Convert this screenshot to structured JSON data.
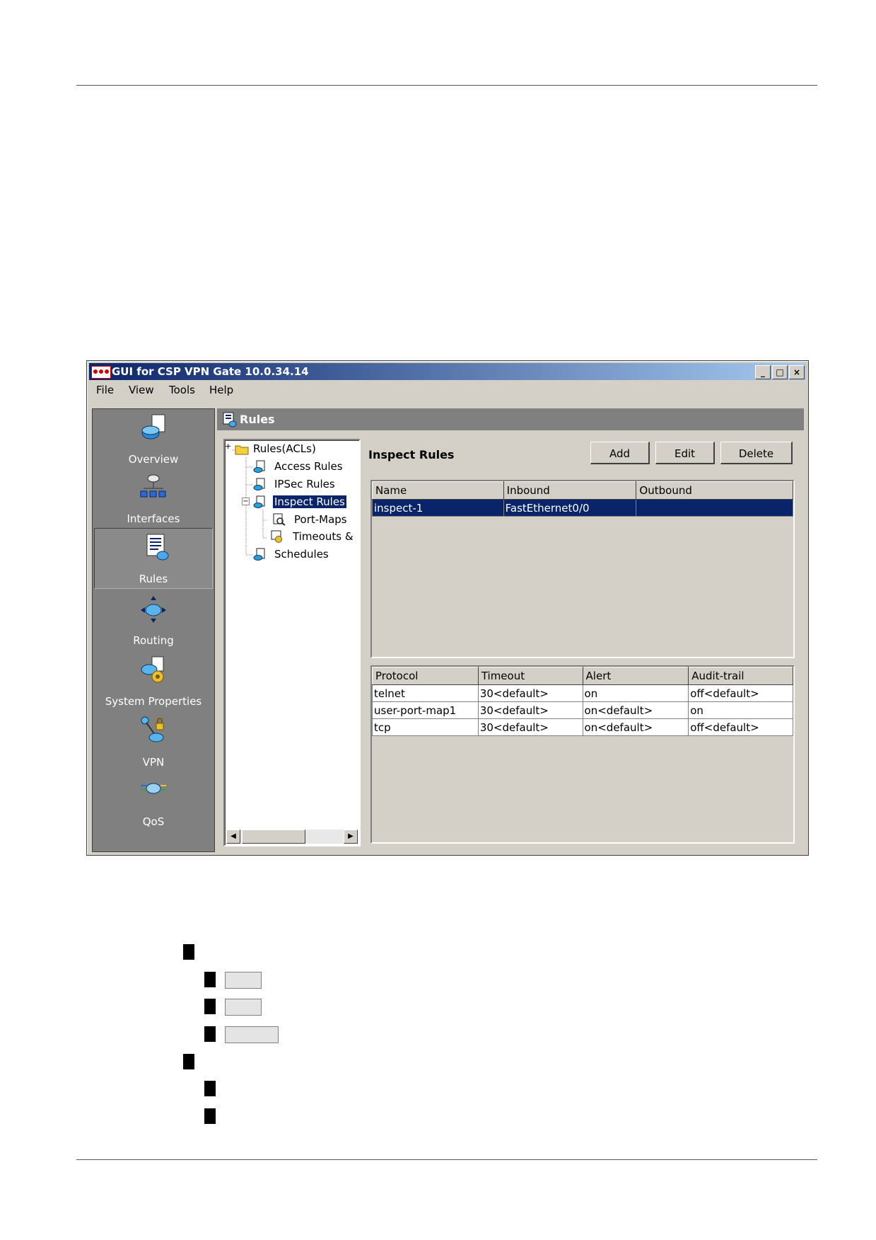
{
  "window": {
    "title": "GUI for CSP VPN Gate 10.0.34.14",
    "controls": {
      "minimize": "_",
      "maximize": "□",
      "close": "×"
    }
  },
  "menu": [
    "File",
    "View",
    "Tools",
    "Help"
  ],
  "nav": {
    "items": [
      {
        "label": "Overview",
        "icon": "overview-icon"
      },
      {
        "label": "Interfaces",
        "icon": "interfaces-icon"
      },
      {
        "label": "Rules",
        "icon": "rules-icon",
        "selected": true
      },
      {
        "label": "Routing",
        "icon": "routing-icon"
      },
      {
        "label": "System Properties",
        "icon": "system-properties-icon"
      },
      {
        "label": "VPN",
        "icon": "vpn-icon"
      },
      {
        "label": "QoS",
        "icon": "qos-icon"
      }
    ]
  },
  "panel": {
    "title": "Rules"
  },
  "tree": {
    "items": [
      {
        "label": "Rules(ACLs)",
        "icon": "folder-icon"
      },
      {
        "label": "Access Rules",
        "icon": "rule-icon"
      },
      {
        "label": "IPSec Rules",
        "icon": "rule-icon"
      },
      {
        "label": "Inspect Rules",
        "icon": "rule-icon",
        "selected": true
      },
      {
        "label": "Port-Maps",
        "icon": "portmap-icon"
      },
      {
        "label": "Timeouts &",
        "icon": "timeouts-icon"
      },
      {
        "label": "Schedules",
        "icon": "rule-icon"
      }
    ],
    "expander_plus": "+",
    "expander_minus": "−"
  },
  "section": {
    "title": "Inspect Rules"
  },
  "buttons": {
    "add": "Add",
    "edit": "Edit",
    "delete": "Delete"
  },
  "rules_table": {
    "columns": [
      "Name",
      "Inbound",
      "Outbound"
    ],
    "rows": [
      [
        "inspect-1",
        "FastEthernet0/0",
        ""
      ]
    ]
  },
  "protocol_table": {
    "columns": [
      "Protocol",
      "Timeout",
      "Alert",
      "Audit-trail"
    ],
    "rows": [
      [
        "telnet",
        "30<default>",
        "on",
        "off<default>"
      ],
      [
        "user-port-map1",
        "30<default>",
        "on<default>",
        "on"
      ],
      [
        "tcp",
        "30<default>",
        "on<default>",
        "off<default>"
      ]
    ]
  },
  "scroll": {
    "left": "◀",
    "right": "▶"
  },
  "colors": {
    "selection": "#0a246a",
    "nav_bg": "#808080",
    "face": "#d4d0c8"
  }
}
